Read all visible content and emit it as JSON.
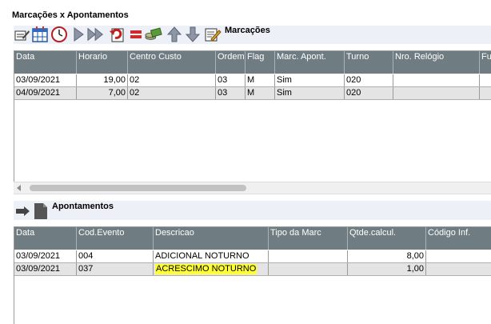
{
  "window": {
    "title": "Marcações x Apontamentos"
  },
  "toolbar": {
    "section_label": "Marcações",
    "buttons": [
      {
        "name": "edit-list-icon"
      },
      {
        "name": "calendar-icon"
      },
      {
        "name": "clock-icon"
      },
      {
        "name": "play-icon"
      },
      {
        "name": "fast-forward-icon"
      },
      {
        "name": "undo-document-icon"
      },
      {
        "name": "equals-icon"
      },
      {
        "name": "money-icon"
      },
      {
        "name": "arrow-up-icon"
      },
      {
        "name": "arrow-down-icon"
      },
      {
        "name": "edit-note-icon"
      }
    ]
  },
  "marcacoes": {
    "columns": [
      "Data",
      "Horario",
      "Centro Custo",
      "Ordem",
      "Flag",
      "Marc. Apont.",
      "Turno",
      "Nro. Relógio",
      "Fu"
    ],
    "rows": [
      [
        "03/09/2021",
        "19,00",
        "02",
        "03",
        "M",
        "Sim",
        "020",
        "",
        ""
      ],
      [
        "04/09/2021",
        "7,00",
        "02",
        "03",
        "M",
        "Sim",
        "020",
        "",
        ""
      ]
    ]
  },
  "apontamentos": {
    "section_label": "Apontamentos",
    "buttons": [
      {
        "name": "forward-arrow-icon"
      },
      {
        "name": "document-icon"
      }
    ],
    "columns": [
      "Data",
      "Cod.Evento",
      "Descricao",
      "Tipo da Marc",
      "Qtde.calcul.",
      "Código Inf."
    ],
    "rows": [
      [
        "03/09/2021",
        "004",
        "ADICIONAL NOTURNO",
        "",
        "8,00",
        ""
      ],
      [
        "03/09/2021",
        "037",
        "ACRESCIMO NOTURNO",
        "",
        "1,00",
        ""
      ]
    ],
    "highlight_color": "#ffff33"
  }
}
